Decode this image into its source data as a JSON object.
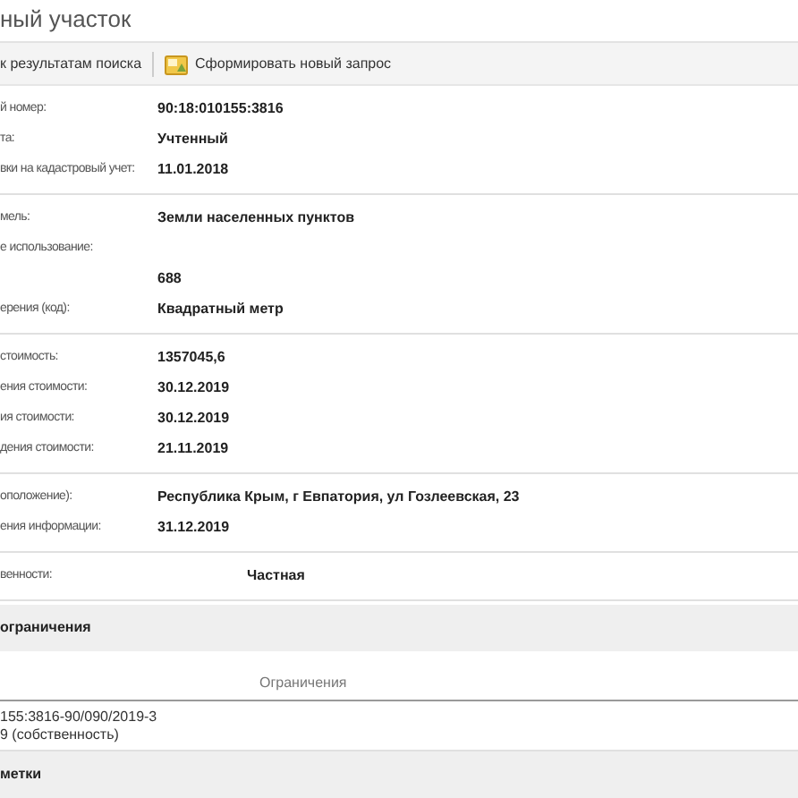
{
  "title": "ный участок",
  "toolbar": {
    "back_link": "к результатам поиска",
    "new_request": "Сформировать новый запрос"
  },
  "sections": [
    {
      "kind": "fields",
      "rows": [
        {
          "label": "й номер:",
          "value": "90:18:010155:3816"
        },
        {
          "label": "та:",
          "value": "Учтенный"
        },
        {
          "label": "вки на кадастровый учет:",
          "value": "11.01.2018"
        }
      ]
    },
    {
      "kind": "fields",
      "rows": [
        {
          "label": "мель:",
          "value": "Земли населенных пунктов"
        },
        {
          "label": "е использование:"
        },
        {
          "value": "688"
        },
        {
          "label": "ерения (код):",
          "value": "Квадратный метр"
        }
      ]
    },
    {
      "kind": "fields",
      "rows": [
        {
          "label": "стоимость:",
          "value": "1357045,6"
        },
        {
          "label": "ения стоимости:",
          "value": "30.12.2019"
        },
        {
          "label": "ия стоимости:",
          "value": "30.12.2019"
        },
        {
          "label": "дения стоимости:",
          "value": "21.11.2019"
        }
      ]
    },
    {
      "kind": "fields",
      "rows": [
        {
          "label": "оположение):",
          "value": "Республика Крым, г Евпатория, ул Гозлеевская, 23"
        },
        {
          "label": "ения информации:",
          "value": "31.12.2019"
        }
      ]
    },
    {
      "kind": "wide-fields",
      "rows": [
        {
          "label": "венности:",
          "value": "Частная"
        }
      ]
    },
    {
      "kind": "heading",
      "text": "ограничения"
    },
    {
      "kind": "table",
      "column": "Ограничения",
      "lines": [
        "155:3816-90/090/2019-3",
        "9 (собственность)"
      ]
    },
    {
      "kind": "heading",
      "text": "метки"
    }
  ]
}
